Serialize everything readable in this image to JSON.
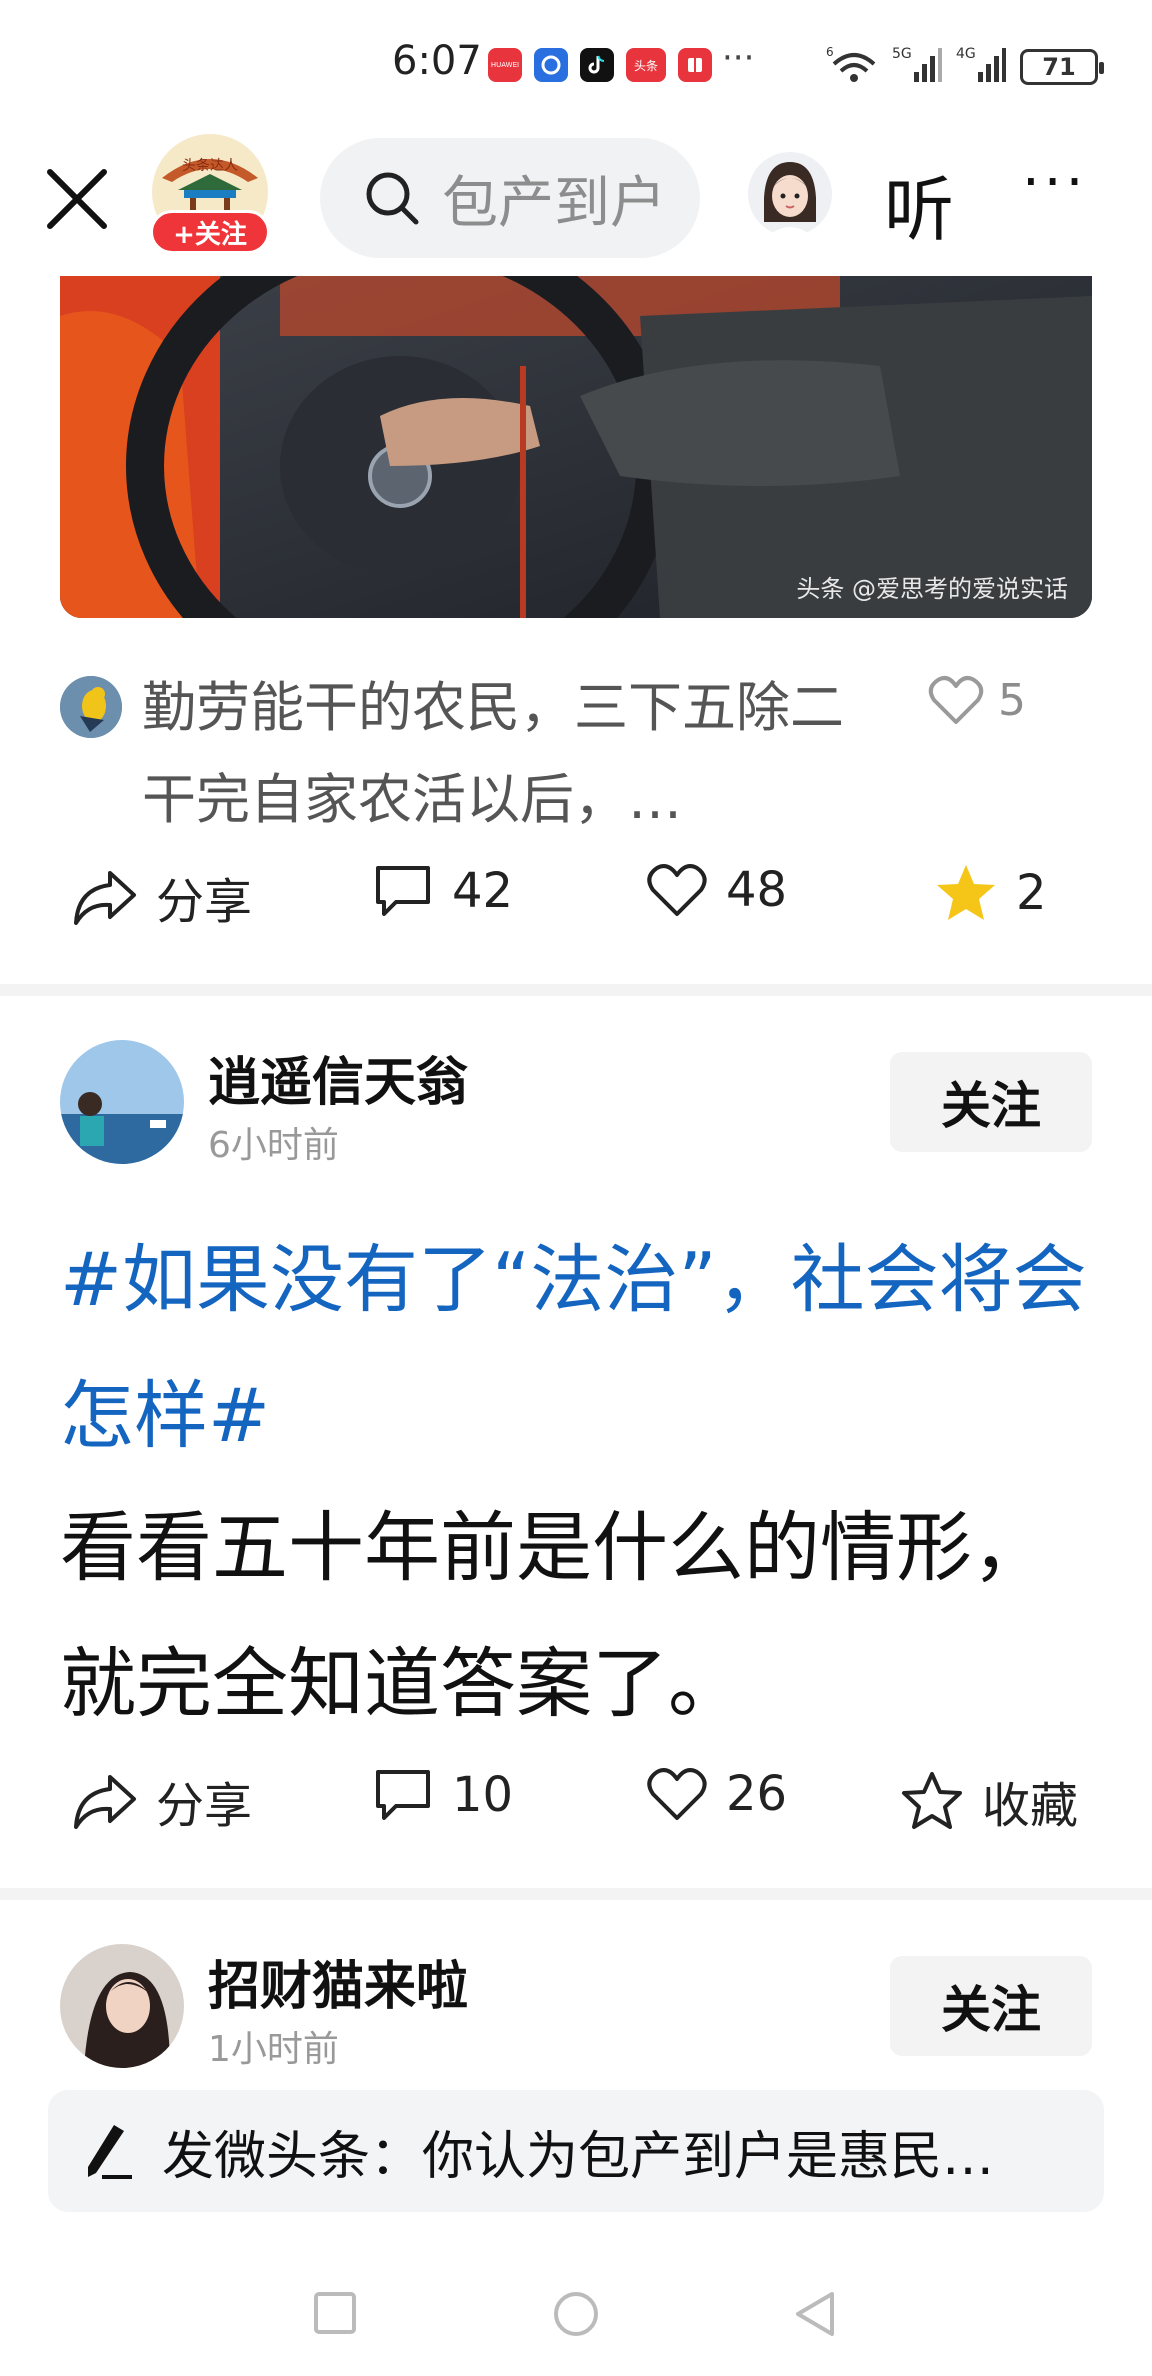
{
  "status_bar": {
    "time": "6:07",
    "apps": [
      {
        "name": "huawei-app-icon",
        "label": "HUAWEI",
        "color": "#e8353d"
      },
      {
        "name": "blue-app-icon",
        "label": "",
        "color": "#2a6fe0"
      },
      {
        "name": "tiktok-app-icon",
        "label": "",
        "color": "#111111"
      },
      {
        "name": "toutiao-app-icon",
        "label": "头条",
        "color": "#e8353d"
      },
      {
        "name": "book-app-icon",
        "label": "",
        "color": "#e8353d"
      }
    ],
    "more": "···",
    "signal_labels": [
      "6",
      "5G",
      "4G"
    ],
    "battery": "71"
  },
  "header": {
    "logo_text": "头条达人",
    "follow_badge": "+关注",
    "search_placeholder": "包产到户",
    "listen_label": "听",
    "more_label": "···"
  },
  "post1": {
    "image_watermark": "头条 @爱思考的爱说实话",
    "snippet": "勤劳能干的农民，三下五除二干完自家农活以后，…",
    "snippet_likes": "5",
    "actions": {
      "share": "分享",
      "comments": "42",
      "likes": "48",
      "favorites": "2"
    }
  },
  "post2": {
    "author": "逍遥信天翁",
    "time": "6小时前",
    "follow": "关注",
    "hashtag": "#如果没有了“法治”，社会将会怎样#",
    "body": "看看五十年前是什么的情形，就完全知道答案了。",
    "actions": {
      "share": "分享",
      "comments": "10",
      "likes": "26",
      "favorite": "收藏"
    }
  },
  "post3": {
    "author": "招财猫来啦",
    "time": "1小时前",
    "follow": "关注"
  },
  "compose": {
    "text": "发微头条：你认为包产到户是惠民…"
  },
  "colors": {
    "accent_red": "#f0353a",
    "hashtag_blue": "#1465c0",
    "star_yellow": "#f5c518"
  }
}
